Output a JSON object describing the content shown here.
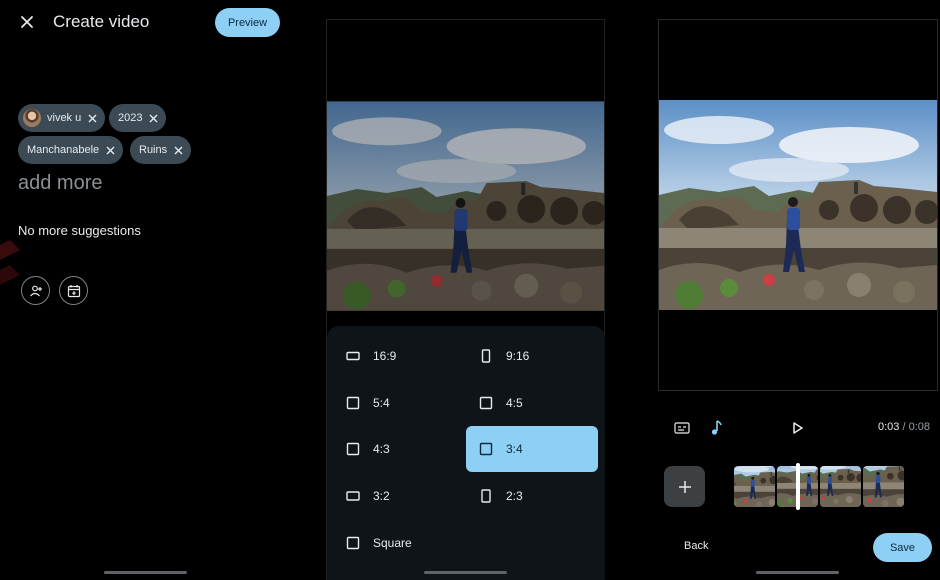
{
  "left_panel": {
    "title": "Create video",
    "preview_label": "Preview",
    "chips": [
      {
        "label": "vivek u",
        "has_avatar": true
      },
      {
        "label": "2023"
      },
      {
        "label": "Manchanabele"
      },
      {
        "label": "Ruins"
      }
    ],
    "add_more_placeholder": "add more",
    "no_suggestions": "No more suggestions",
    "icons": [
      "close-icon",
      "add-person-icon",
      "add-date-icon"
    ]
  },
  "aspect_panel": {
    "options": [
      {
        "label": "16:9",
        "shape": "wide"
      },
      {
        "label": "9:16",
        "shape": "tall"
      },
      {
        "label": "5:4",
        "shape": "square"
      },
      {
        "label": "4:5",
        "shape": "square"
      },
      {
        "label": "4:3",
        "shape": "square"
      },
      {
        "label": "3:4",
        "shape": "square",
        "selected": true
      },
      {
        "label": "3:2",
        "shape": "wide"
      },
      {
        "label": "2:3",
        "shape": "tall"
      },
      {
        "label": "Square",
        "shape": "square"
      }
    ],
    "selected_color": "#8ecff6"
  },
  "editor_panel": {
    "time_current": "0:03",
    "time_separator": " / ",
    "time_total": "0:08",
    "back_label": "Back",
    "save_label": "Save",
    "icons": [
      "caption-icon",
      "music-note-icon",
      "play-icon",
      "add-clip-icon"
    ],
    "music_icon_color": "#8ecff6",
    "clip_count": 4
  }
}
